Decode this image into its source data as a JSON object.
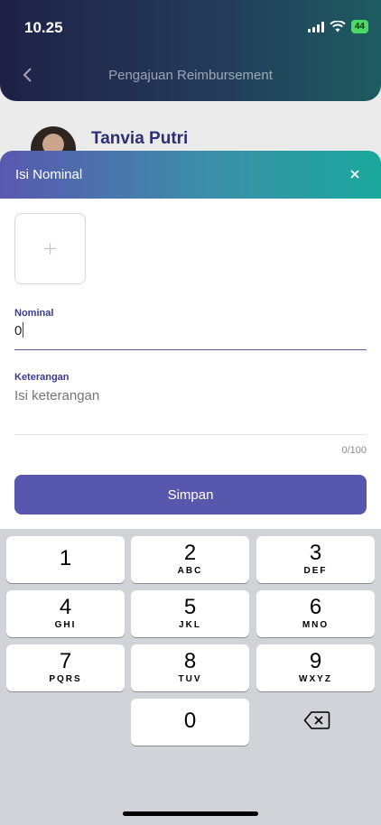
{
  "status_bar": {
    "time": "10.25",
    "battery": "44"
  },
  "header": {
    "title": "Pengajuan Reimbursement"
  },
  "profile": {
    "name": "Tanvia Putri"
  },
  "sheet": {
    "title": "Isi Nominal",
    "photo_icon": "plus-icon",
    "nominal_label": "Nominal",
    "nominal_value": "0",
    "keterangan_label": "Keterangan",
    "keterangan_placeholder": "Isi keterangan",
    "counter": "0/100",
    "save_label": "Simpan"
  },
  "keyboard": {
    "keys": [
      {
        "num": "1",
        "letters": ""
      },
      {
        "num": "2",
        "letters": "ABC"
      },
      {
        "num": "3",
        "letters": "DEF"
      },
      {
        "num": "4",
        "letters": "GHI"
      },
      {
        "num": "5",
        "letters": "JKL"
      },
      {
        "num": "6",
        "letters": "MNO"
      },
      {
        "num": "7",
        "letters": "PQRS"
      },
      {
        "num": "8",
        "letters": "TUV"
      },
      {
        "num": "9",
        "letters": "WXYZ"
      },
      {
        "num": "0",
        "letters": ""
      }
    ],
    "delete_icon": "backspace-icon"
  },
  "colors": {
    "accent": "#5758ad",
    "header_gradient_end": "#1aa89d",
    "label": "#3b3a8f"
  }
}
